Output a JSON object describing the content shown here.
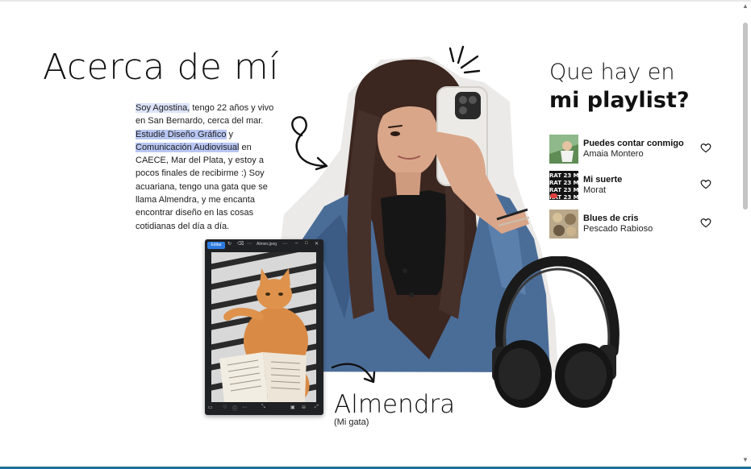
{
  "about": {
    "title": "Acerca de mí",
    "bio": {
      "p1": "Soy Agostina,",
      "p2": " tengo 22 años y vivo en San Bernardo, cerca del mar. ",
      "p3": "Estudié Diseño Gráfico",
      "p4": " y ",
      "p5": "Comunicación Audiovisual",
      "p6": " en CAECE, Mar del Plata, y estoy a pocos finales de recibirme :) Soy acuariana, tengo una gata que se llama Almendra, y me encanta encontrar diseño en las cosas cotidianas del día a día."
    }
  },
  "photo_window": {
    "edit_label": "Editar",
    "filename": "Almen.jpeg"
  },
  "cat": {
    "name": "Almendra",
    "caption": "(Mi gata)"
  },
  "playlist": {
    "title_line1": "Que hay en",
    "title_line2": "mi playlist?",
    "songs": [
      {
        "title": "Puedes contar conmigo",
        "artist": "Amaia Montero"
      },
      {
        "title": "Mi suerte",
        "artist": "Morat"
      },
      {
        "title": "Blues de cris",
        "artist": "Pescado Rabioso"
      }
    ]
  },
  "colors": {
    "highlight": "#b9c6f3",
    "accent_bar": "#1e6f92",
    "text": "#111111"
  }
}
